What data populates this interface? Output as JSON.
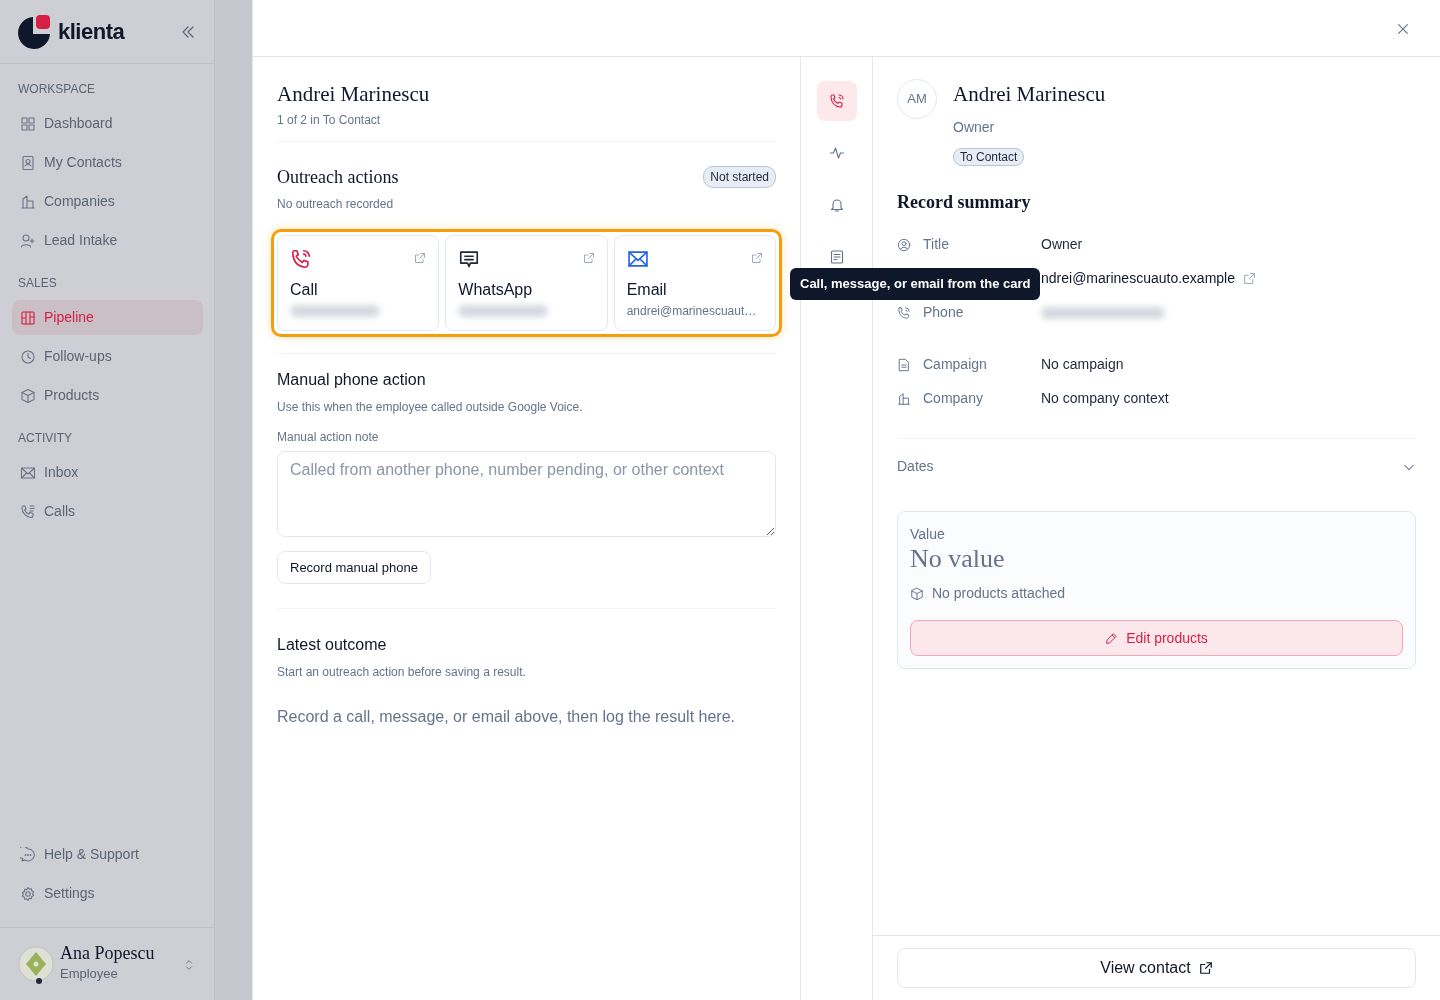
{
  "sidebar": {
    "brand": "klienta",
    "sections": [
      {
        "label": "WORKSPACE",
        "items": [
          {
            "label": "Dashboard",
            "selected": false
          },
          {
            "label": "My Contacts",
            "selected": false
          },
          {
            "label": "Companies",
            "selected": false
          },
          {
            "label": "Lead Intake",
            "selected": false
          }
        ]
      },
      {
        "label": "SALES",
        "items": [
          {
            "label": "Pipeline",
            "selected": true
          },
          {
            "label": "Follow-ups",
            "selected": false
          },
          {
            "label": "Products",
            "selected": false
          }
        ]
      },
      {
        "label": "ACTIVITY",
        "items": [
          {
            "label": "Inbox",
            "selected": false
          },
          {
            "label": "Calls",
            "selected": false
          }
        ]
      }
    ],
    "footer_items": [
      {
        "label": "Help & Support",
        "selected": false
      },
      {
        "label": "Settings",
        "selected": false
      }
    ],
    "user": {
      "name": "Ana Popescu",
      "role": "Employee",
      "online": true
    }
  },
  "record": {
    "title": "Andrei Marinescu",
    "position": "1 of 2 in To Contact",
    "outreach": {
      "title": "Outreach actions",
      "status": "Not started",
      "note": "No outreach recorded",
      "highlighted": true,
      "actions": [
        {
          "kind": "call",
          "label": "Call",
          "redacted": true
        },
        {
          "kind": "whatsapp",
          "label": "WhatsApp",
          "redacted": true
        },
        {
          "kind": "email",
          "label": "Email",
          "detail": "andrei@marinescuaut…",
          "redacted": false
        }
      ]
    },
    "manual": {
      "title": "Manual phone action",
      "hint": "Use this when the employee called outside Google Voice.",
      "field_label": "Manual action note",
      "placeholder": "Called from another phone, number pending, or other context",
      "button": "Record manual phone"
    },
    "outcome": {
      "title": "Latest outcome",
      "hint": "Start an outreach action before saving a result.",
      "empty": "Record a call, message, or email above, then log the result here."
    }
  },
  "rail": [
    {
      "selected": true
    },
    {
      "selected": false
    },
    {
      "selected": false
    },
    {
      "selected": false
    }
  ],
  "tooltip": "Call, message, or email from the card",
  "contact": {
    "initials": "AM",
    "name": "Andrei Marinescu",
    "role": "Owner",
    "tag": "To Contact",
    "summary_title": "Record summary",
    "field_groups": [
      [
        {
          "kind": "text",
          "label": "Title",
          "value": "Owner"
        },
        {
          "kind": "link",
          "value": "ndrei@marinescuauto.example"
        },
        {
          "kind": "redacted",
          "label": "Phone"
        }
      ],
      [
        {
          "kind": "text",
          "label": "Campaign",
          "value": "No campaign"
        },
        {
          "kind": "text",
          "label": "Company",
          "value": "No company context"
        }
      ]
    ],
    "dates": {
      "label": "Dates",
      "expanded": false
    },
    "value_card": {
      "label": "Value",
      "value": "No value",
      "products": "No products attached",
      "button": "Edit products"
    },
    "footer_button": "View contact"
  }
}
